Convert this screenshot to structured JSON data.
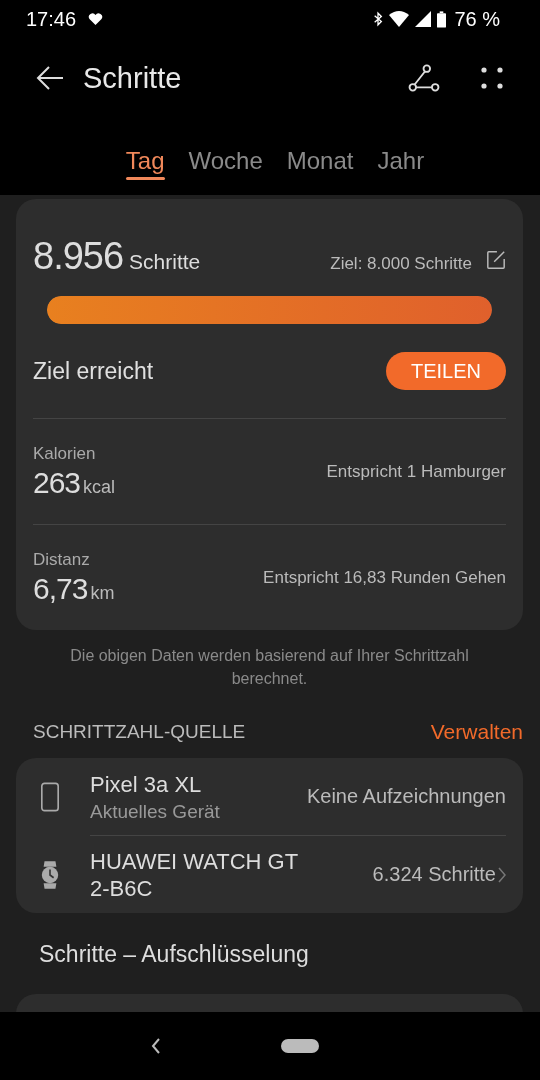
{
  "status_bar": {
    "time": "17:46",
    "battery": "76 %"
  },
  "app_bar": {
    "title": "Schritte"
  },
  "tabs": [
    {
      "label": "Tag",
      "selected": true
    },
    {
      "label": "Woche",
      "selected": false
    },
    {
      "label": "Monat",
      "selected": false
    },
    {
      "label": "Jahr",
      "selected": false
    }
  ],
  "summary": {
    "steps": "8.956",
    "steps_unit": "Schritte",
    "goal": "Ziel: 8.000 Schritte",
    "level": 1,
    "goal_status": "Ziel erreicht",
    "share_button": "TEILEN",
    "metrics": [
      {
        "label": "Kalorien",
        "value": "263",
        "unit": "kcal",
        "equivalent": "Entspricht 1 Hamburger"
      },
      {
        "label": "Distanz",
        "value": "6,73",
        "unit": "km",
        "equivalent": "Entspricht 16,83 Runden Gehen"
      }
    ]
  },
  "note": "Die obigen Daten werden basierend auf Ihrer Schrittzahl berechnet.",
  "source": {
    "heading": "SCHRITTZAHL-QUELLE",
    "manage_link": "Verwalten",
    "devices": [
      {
        "kind": "phone",
        "name": "Pixel 3a XL",
        "subtitle": "Aktuelles Gerät",
        "value": "Keine Aufzeichnungen",
        "chevron": false
      },
      {
        "kind": "watch",
        "name": "HUAWEI WATCH GT 2-B6C",
        "value": "6.324 Schritte",
        "chevron": true
      }
    ]
  },
  "breakdown": {
    "title": "Schritte – Aufschlüsselung"
  }
}
